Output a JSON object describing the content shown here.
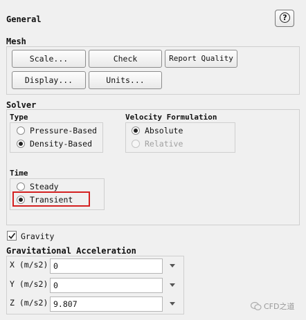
{
  "panel": {
    "title": "General",
    "help_icon_glyph": "?"
  },
  "mesh": {
    "title": "Mesh",
    "buttons": {
      "scale": "Scale...",
      "check": "Check",
      "report_quality": "Report Quality",
      "display": "Display...",
      "units": "Units..."
    }
  },
  "solver": {
    "title": "Solver",
    "type": {
      "title": "Type",
      "options": [
        "Pressure-Based",
        "Density-Based"
      ],
      "selected": "Density-Based"
    },
    "velocity": {
      "title": "Velocity Formulation",
      "options": [
        "Absolute",
        "Relative"
      ],
      "selected": "Absolute",
      "disabled": [
        "Relative"
      ]
    },
    "time": {
      "title": "Time",
      "options": [
        "Steady",
        "Transient"
      ],
      "selected": "Transient",
      "highlight_color": "#d42020"
    }
  },
  "gravity": {
    "label": "Gravity",
    "checked": true
  },
  "grav_accel": {
    "title": "Gravitational Acceleration",
    "rows": [
      {
        "label": "X (m/s2)",
        "value": "0"
      },
      {
        "label": "Y (m/s2)",
        "value": "0"
      },
      {
        "label": "Z (m/s2)",
        "value": "9.807"
      }
    ]
  },
  "watermark": {
    "text": "CFD之道",
    "icon": "wechat-icon"
  }
}
